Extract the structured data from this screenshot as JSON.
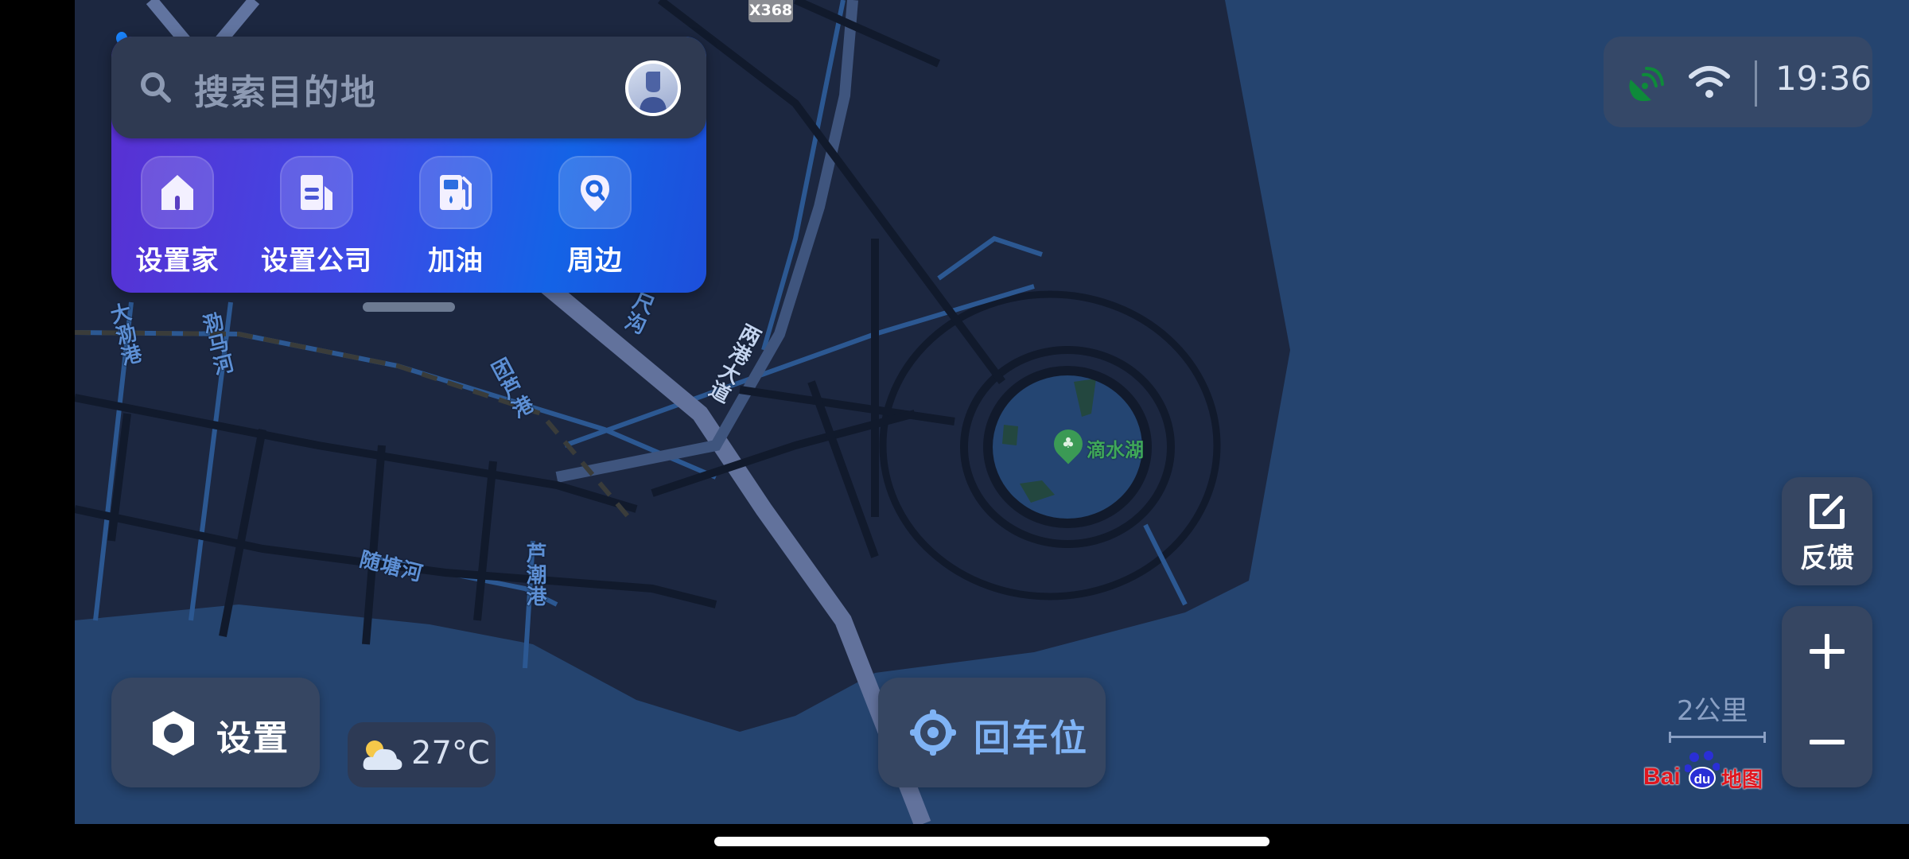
{
  "search": {
    "placeholder": "搜索目的地",
    "search_icon": "search-icon",
    "avatar_icon": "user-avatar-icon"
  },
  "quick_actions": [
    {
      "label": "设置家",
      "icon": "home-icon"
    },
    {
      "label": "设置公司",
      "icon": "company-building-icon"
    },
    {
      "label": "加油",
      "icon": "gas-station-icon"
    },
    {
      "label": "周边",
      "icon": "nearby-location-pin-icon"
    }
  ],
  "status": {
    "gps_icon": "satellite-signal-icon",
    "gps_color": "#0e8a3a",
    "wifi_icon": "wifi-icon",
    "time": "19:36"
  },
  "controls": {
    "feedback_label": "反馈",
    "feedback_icon": "edit-square-icon",
    "zoom_in_icon": "plus-icon",
    "zoom_out_icon": "minus-icon"
  },
  "scale": {
    "text": "2公里"
  },
  "logo": {
    "prefix": "Bai",
    "paw_text": "du",
    "suffix": "地图"
  },
  "bottom": {
    "settings_label": "设置",
    "settings_icon": "hexagon-settings-icon",
    "weather_icon": "partly-cloudy-icon",
    "temperature": "27°C",
    "recenter_label": "回车位",
    "recenter_icon": "locate-crosshair-icon",
    "recenter_color": "#7fb3f5"
  },
  "map": {
    "road_shield": "X368",
    "poi": {
      "name": "滴水湖",
      "icon": "park-tree-icon",
      "color": "#3fa85a"
    },
    "labels": [
      {
        "text": "大泐港"
      },
      {
        "text": "泐马河"
      },
      {
        "text": "团芦港"
      },
      {
        "text": "尺沟"
      },
      {
        "text": "两港大道"
      },
      {
        "text": "随塘河"
      },
      {
        "text": "芦潮港"
      }
    ]
  }
}
